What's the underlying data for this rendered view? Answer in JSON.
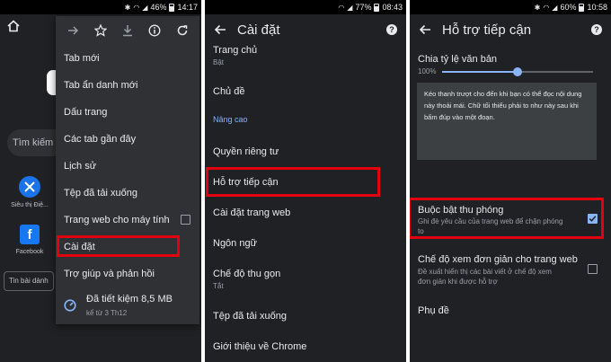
{
  "colors": {
    "bg": "#202124",
    "menu": "#303134",
    "accent": "#8ab4f8",
    "highlight": "#e3000f",
    "text": "#e8eaed",
    "subtext": "#9aa0a6"
  },
  "screens": [
    {
      "status": {
        "battery": "46%",
        "time": "14:17",
        "icons": [
          "bluetooth-icon",
          "wifi-icon",
          "signal-icon"
        ]
      },
      "background": {
        "search_placeholder": "Tìm kiếm",
        "shortcuts": [
          {
            "label": "Siêu thị Điệ...",
            "icon": "tools-icon"
          },
          {
            "label": "Facebook",
            "icon": "facebook-icon"
          }
        ],
        "news_placeholder": "Tin bài dành"
      },
      "menu": {
        "top_icons": [
          "forward-icon",
          "star-icon",
          "download-icon",
          "info-icon",
          "refresh-icon"
        ],
        "items": [
          {
            "label": "Tab mới"
          },
          {
            "label": "Tab ẩn danh mới"
          },
          {
            "label": "Dấu trang"
          },
          {
            "label": "Các tab gần đây"
          },
          {
            "label": "Lịch sử"
          },
          {
            "label": "Tệp đã tải xuống"
          },
          {
            "label": "Trang web cho máy tính",
            "checkbox": false
          },
          {
            "label": "Cài đặt",
            "highlighted": true
          },
          {
            "label": "Trợ giúp và phản hồi"
          }
        ],
        "data_saved": {
          "title": "Đã tiết kiệm 8,5 MB",
          "subtitle": "kể từ 3 Th12"
        }
      }
    },
    {
      "status": {
        "battery": "77%",
        "time": "08:43"
      },
      "title": "Cài đặt",
      "items": [
        {
          "label": "Trang chủ",
          "sub": "Bật"
        },
        {
          "label": "Chủ đề"
        },
        {
          "section": "Nâng cao"
        },
        {
          "label": "Quyền riêng tư"
        },
        {
          "label": "Hỗ trợ tiếp cận",
          "highlighted": true
        },
        {
          "label": "Cài đặt trang web"
        },
        {
          "label": "Ngôn ngữ"
        },
        {
          "label": "Chế độ thu gọn",
          "sub": "Tắt"
        },
        {
          "label": "Tệp đã tải xuống"
        },
        {
          "label": "Giới thiệu về Chrome"
        }
      ]
    },
    {
      "status": {
        "battery": "60%",
        "time": "10:58"
      },
      "title": "Hỗ trợ tiếp cận",
      "text_scaling": {
        "label": "Chia tỷ lệ văn bản",
        "value": "100%",
        "slider_fraction": 0.5
      },
      "preview_text": "Kéo thanh trượt cho đến khi bạn có thể đọc nội dung này thoải mái. Chữ tối thiểu phải to như này sau khi bấm đúp vào một đoạn.",
      "force_zoom": {
        "title": "Buộc bật thu phóng",
        "desc_line1": "Ghi đè yêu cầu của trang web để chặn phóng",
        "desc_line2": "to",
        "checked": true,
        "highlighted": true
      },
      "simplified_view": {
        "title": "Chế độ xem đơn giản cho trang web",
        "desc_line1": "Đề xuất hiển thị các bài viết ở chế độ xem",
        "desc_line2": "đơn giản khi được hỗ trợ",
        "checked": false
      },
      "captions": {
        "title": "Phụ đề"
      }
    }
  ]
}
